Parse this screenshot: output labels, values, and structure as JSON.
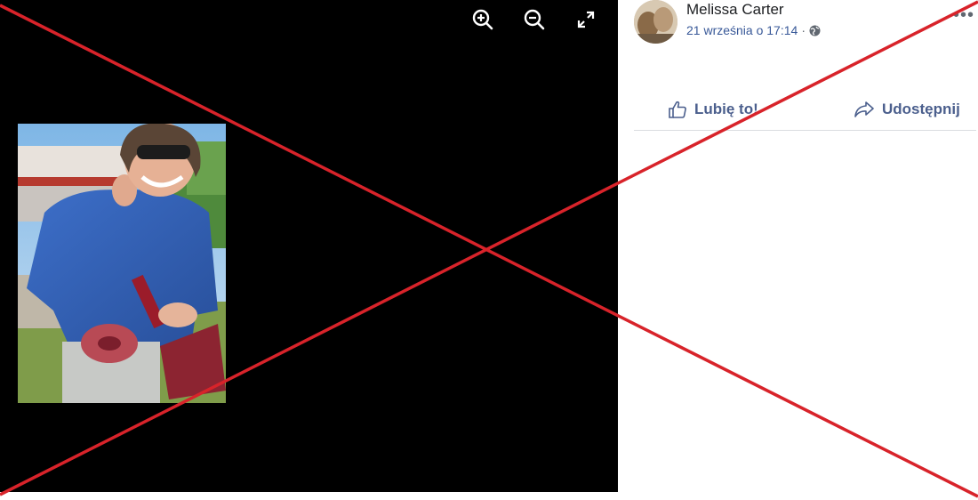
{
  "viewer": {
    "tools": [
      {
        "name": "zoom-in-icon"
      },
      {
        "name": "zoom-out-icon"
      },
      {
        "name": "fullscreen-icon"
      }
    ],
    "photo_icon": "photo-woman-in-blue-shirt"
  },
  "post": {
    "author": "Melissa Carter",
    "date": "21 września o 17:14",
    "separator": "·",
    "privacy_icon": "globe-icon",
    "more_label": "•••"
  },
  "actions": {
    "like_label": "Lubię to!",
    "share_label": "Udostępnij"
  },
  "colors": {
    "viewer_bg": "#000000",
    "link_blue": "#4b5f8d",
    "date_blue": "#385898",
    "overlay_red": "#d8232a"
  }
}
